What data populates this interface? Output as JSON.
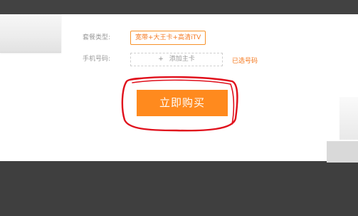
{
  "form": {
    "plan_type_label": "套餐类型:",
    "plan_value": "宽带+大王卡+高清iTV",
    "phone_label": "手机号码:",
    "add_card_plus": "+",
    "add_card_label": "添加主卡",
    "selected_numbers_link": "已选号码"
  },
  "actions": {
    "buy_now_label": "立即购买"
  },
  "colors": {
    "accent": "#ff8a1e",
    "annotation": "#e0101c"
  }
}
